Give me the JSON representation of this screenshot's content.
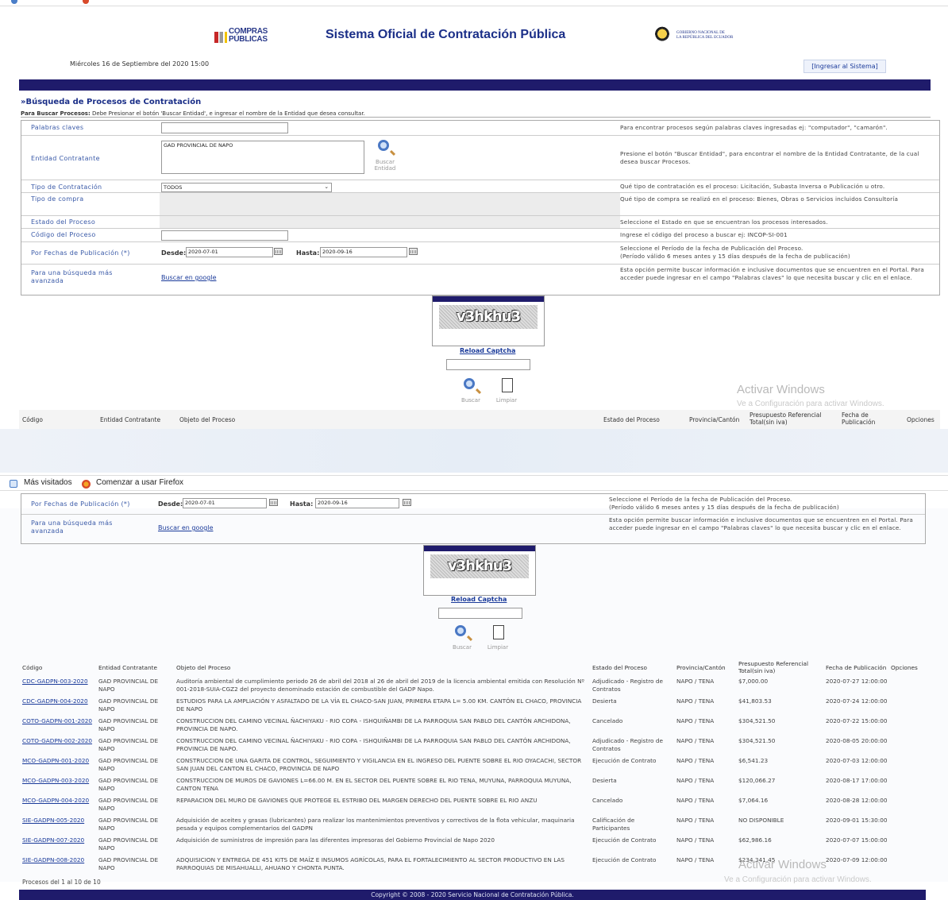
{
  "header": {
    "logo_line1": "COMPRAS",
    "logo_line2": "PÚBLICAS",
    "title": "Sistema Oficial de Contratación Pública",
    "gov_line1": "GOBIERNO NACIONAL DE",
    "gov_line2": "LA REPÚBLICA DEL ECUADOR",
    "date": "Miércoles 16 de Septiembre del 2020 15:00",
    "login_label": "[Ingresar al Sistema]"
  },
  "search": {
    "section_title": "»Búsqueda de Procesos de Contratación",
    "info_bold": "Para Buscar Procesos:",
    "info_text": " Debe Presionar el botón 'Buscar Entidad', e ingresar el nombre de la Entidad que desea consultar.",
    "rows": {
      "keywords": {
        "label": "Palabras claves",
        "value": "",
        "hint": "Para encontrar procesos según palabras claves ingresadas ej: \"computador\", \"camarón\"."
      },
      "entity": {
        "label": "Entidad Contratante",
        "value": "GAD PROVINCIAL DE NAPO",
        "button_label_1": "Buscar",
        "button_label_2": "Entidad",
        "hint": "Presione el botón \"Buscar Entidad\", para encontrar el nombre de la Entidad Contratante, de la cual desea buscar Procesos."
      },
      "contract_type": {
        "label": "Tipo de Contratación",
        "value": "TODOS",
        "hint": "Qué tipo de contratación es el proceso: Licitación, Subasta Inversa o Publicación u otro."
      },
      "purchase_type": {
        "label": "Tipo de compra",
        "hint": "Qué tipo de compra se realizó en el proceso: Bienes, Obras o Servicios incluidos Consultoría"
      },
      "state": {
        "label": "Estado del Proceso",
        "hint": "Seleccione el Estado en que se encuentran los procesos interesados."
      },
      "code": {
        "label": "Código del Proceso",
        "value": "",
        "hint": "Ingrese el código del proceso a buscar ej: INCOP-SI-001"
      },
      "dates": {
        "label": "Por Fechas de Publicación (*)",
        "from_label": "Desde:",
        "from_value": "2020-07-01",
        "to_label": "Hasta:",
        "to_value": "2020-09-16",
        "hint_1": "Seleccione el Período de la fecha de Publicación del Proceso.",
        "hint_2": "(Período válido 6 meses antes y 15 días después de la fecha de publicación)"
      },
      "advanced": {
        "label": "Para una búsqueda más avanzada",
        "link": "Buscar en google",
        "hint": "Esta opción permite buscar información e inclusive documentos que se encuentren en el Portal. Para acceder puede ingresar en el campo \"Palabras claves\" lo que necesita buscar y clic en el enlace."
      }
    },
    "captcha_text": "v3hkhu3",
    "reload_label": "Reload Captcha",
    "captcha_input": "",
    "search_button": "Buscar",
    "clear_button": "Limpiar"
  },
  "watermark": {
    "line1": "Activar Windows",
    "line2": "Ve a Configuración para activar Windows."
  },
  "bookmarks": {
    "item1": "Más visitados",
    "item2": "Comenzar a usar Firefox"
  },
  "table": {
    "headers": [
      "Código",
      "Entidad Contratante",
      "Objeto del Proceso",
      "Estado del Proceso",
      "Provincia/Cantón",
      "Presupuesto Referencial Total(sin iva)",
      "Fecha de Publicación",
      "Opciones"
    ],
    "rows": [
      {
        "code": "CDC-GADPN-003-2020",
        "entity": "GAD PROVINCIAL DE NAPO",
        "object": "Auditoría ambiental de cumplimiento periodo 26 de abril del 2018 al 26 de abril del 2019 de la licencia ambiental emitida con Resolución Nº 001-2018-SUIA-CGZ2 del proyecto denominado estación de combustible del GADP Napo.",
        "state": "Adjudicado - Registro de Contratos",
        "place": "NAPO / TENA",
        "budget": "$7,000.00",
        "date": "2020-07-27 12:00:00"
      },
      {
        "code": "CDC-GADPN-004-2020",
        "entity": "GAD PROVINCIAL DE NAPO",
        "object": "ESTUDIOS PARA LA AMPLIACIÓN Y ASFALTADO DE LA VÍA EL CHACO-SAN JUAN, PRIMERA ETAPA L= 5.00 KM. CANTÓN EL CHACO, PROVINCIA DE NAPO",
        "state": "Desierta",
        "place": "NAPO / TENA",
        "budget": "$41,803.53",
        "date": "2020-07-24 12:00:00"
      },
      {
        "code": "COTO-GADPN-001-2020",
        "entity": "GAD PROVINCIAL DE NAPO",
        "object": "CONSTRUCCION DEL CAMINO VECINAL ÑACHIYAKU - RIO COPA - ISHQUIÑAMBI DE LA PARROQUIA SAN PABLO DEL CANTÓN ARCHIDONA, PROVINCIA DE NAPO.",
        "state": "Cancelado",
        "place": "NAPO / TENA",
        "budget": "$304,521.50",
        "date": "2020-07-22 15:00:00"
      },
      {
        "code": "COTO-GADPN-002-2020",
        "entity": "GAD PROVINCIAL DE NAPO",
        "object": "CONSTRUCCION DEL CAMINO VECINAL ÑACHIYAKU - RIO COPA - ISHQUIÑAMBI DE LA PARROQUIA SAN PABLO DEL CANTÓN ARCHIDONA, PROVINCIA DE NAPO.",
        "state": "Adjudicado - Registro de Contratos",
        "place": "NAPO / TENA",
        "budget": "$304,521.50",
        "date": "2020-08-05 20:00:00"
      },
      {
        "code": "MCO-GADPN-001-2020",
        "entity": "GAD PROVINCIAL DE NAPO",
        "object": "CONSTRUCCION DE UNA GARITA DE CONTROL, SEGUIMIENTO Y VIGILANCIA EN EL INGRESO DEL PUENTE SOBRE EL RIO OYACACHI, SECTOR SAN JUAN DEL CANTON EL CHACO, PROVINCIA DE NAPO",
        "state": "Ejecución de Contrato",
        "place": "NAPO / TENA",
        "budget": "$6,541.23",
        "date": "2020-07-03 12:00:00"
      },
      {
        "code": "MCO-GADPN-003-2020",
        "entity": "GAD PROVINCIAL DE NAPO",
        "object": "CONSTRUCCION DE MUROS DE GAVIONES L=66.00 M. EN EL SECTOR DEL PUENTE SOBRE EL RIO TENA, MUYUNA, PARROQUIA MUYUNA, CANTON TENA",
        "state": "Desierta",
        "place": "NAPO / TENA",
        "budget": "$120,066.27",
        "date": "2020-08-17 17:00:00"
      },
      {
        "code": "MCO-GADPN-004-2020",
        "entity": "GAD PROVINCIAL DE NAPO",
        "object": "REPARACION DEL MURO DE GAVIONES QUE PROTEGE EL ESTRIBO DEL MARGEN DERECHO DEL PUENTE SOBRE EL RIO ANZU",
        "state": "Cancelado",
        "place": "NAPO / TENA",
        "budget": "$7,064.16",
        "date": "2020-08-28 12:00:00"
      },
      {
        "code": "SIE-GADPN-005-2020",
        "entity": "GAD PROVINCIAL DE NAPO",
        "object": "Adquisición de aceites y grasas (lubricantes) para realizar los mantenimientos preventivos y correctivos de la flota vehicular, maquinaria pesada y equipos complementarios del GADPN",
        "state": "Calificación de Participantes",
        "place": "NAPO / TENA",
        "budget": "NO DISPONIBLE",
        "date": "2020-09-01 15:30:00"
      },
      {
        "code": "SIE-GADPN-007-2020",
        "entity": "GAD PROVINCIAL DE NAPO",
        "object": "Adquisición de suministros de impresión para las diferentes impresoras del Gobierno Provincial de Napo 2020",
        "state": "Ejecución de Contrato",
        "place": "NAPO / TENA",
        "budget": "$62,986.16",
        "date": "2020-07-07 15:00:00"
      },
      {
        "code": "SIE-GADPN-008-2020",
        "entity": "GAD PROVINCIAL DE NAPO",
        "object": "ADQUISICION Y ENTREGA DE 451 KITS DE MAÍZ E INSUMOS AGRÍCOLAS, PARA EL FORTALECIMIENTO AL SECTOR PRODUCTIVO EN LAS PARROQUIAS DE MISAHUALLI, AHUANO Y CHONTA PUNTA.",
        "state": "Ejecución de Contrato",
        "place": "NAPO / TENA",
        "budget": "$234,341.45",
        "date": "2020-07-09 12:00:00"
      }
    ],
    "count": "Procesos del 1 al 10 de 10"
  },
  "footer": "Copyright © 2008 - 2020 Servicio Nacional de Contratación Pública."
}
